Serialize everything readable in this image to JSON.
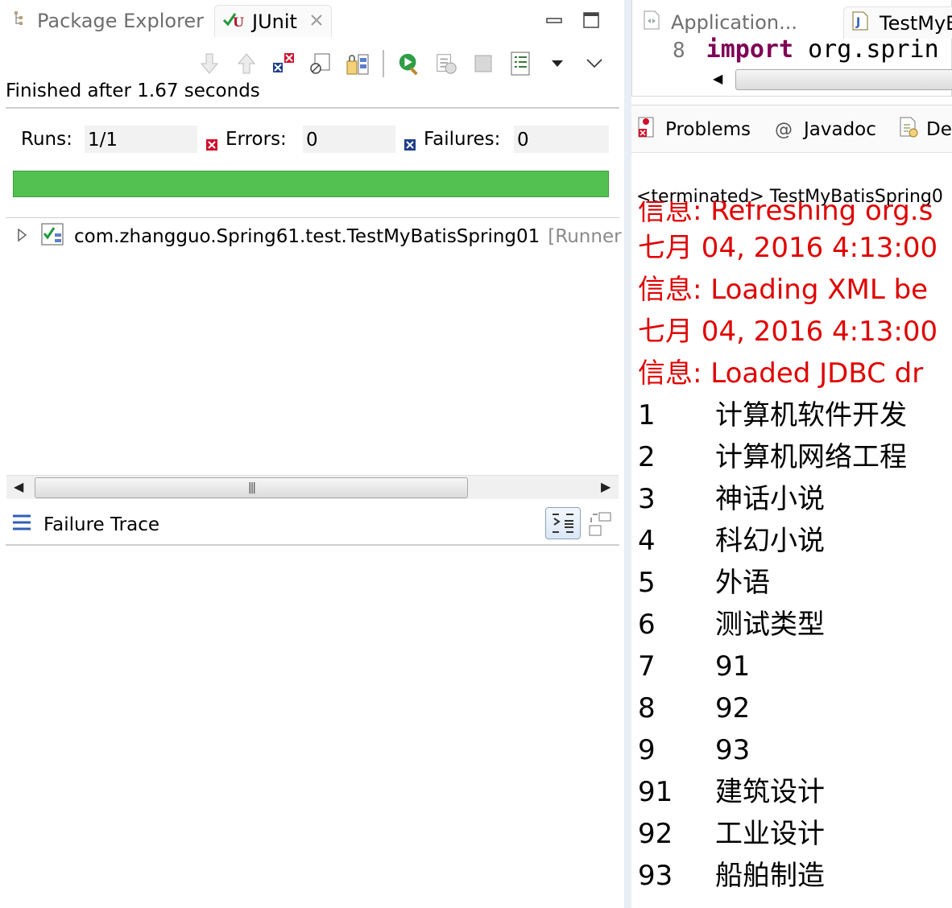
{
  "left": {
    "tabs": [
      {
        "label": "Package Explorer",
        "icon": "package-explorer-icon",
        "active": false
      },
      {
        "label": "JUnit",
        "icon": "junit-icon",
        "active": true
      }
    ],
    "toolbar_icons": [
      "next-failure-icon",
      "previous-failure-icon",
      "show-failures-only-icon",
      "scroll-lock-icon",
      "history-icon",
      "rerun-test-icon",
      "rerun-failed-first-icon",
      "stop-icon",
      "test-run-history-icon",
      "view-menu-icon"
    ],
    "status": "Finished after 1.67 seconds",
    "counters": {
      "runs_label": "Runs:",
      "runs_value": "1/1",
      "errors_label": "Errors:",
      "errors_value": "0",
      "failures_label": "Failures:",
      "failures_value": "0"
    },
    "progress_fraction": 1.0,
    "progress_color": "#52c152",
    "tree": {
      "label": "com.zhangguo.Spring61.test.TestMyBatisSpring01",
      "runner": "[Runner"
    },
    "failure_trace": {
      "label": "Failure Trace"
    }
  },
  "right": {
    "editor_tabs": [
      {
        "label": "Application...",
        "icon": "xml-file-icon"
      },
      {
        "label": "TestMyB",
        "icon": "java-file-icon"
      }
    ],
    "code": {
      "line_number": "8",
      "keyword": "import",
      "text": " org.sprin"
    },
    "console_tabs": [
      {
        "label": "Problems",
        "icon": "problems-icon"
      },
      {
        "label": "Javadoc",
        "icon": "javadoc-icon"
      },
      {
        "label": "De",
        "icon": "declaration-icon"
      }
    ],
    "terminated": "<terminated> TestMyBatisSpring0",
    "log_lines": [
      {
        "text": "信息: Refreshing org.s",
        "red": true,
        "clipped": true
      },
      {
        "text": "七月 04, 2016 4:13:00",
        "red": true
      },
      {
        "text": "信息: Loading XML be",
        "red": true
      },
      {
        "text": "七月 04, 2016 4:13:00",
        "red": true
      },
      {
        "text": "信息: Loaded JDBC dr",
        "red": true
      }
    ],
    "rows": [
      {
        "id": "1",
        "name": "计算机软件开发"
      },
      {
        "id": "2",
        "name": "计算机网络工程"
      },
      {
        "id": "3",
        "name": "神话小说"
      },
      {
        "id": "4",
        "name": "科幻小说"
      },
      {
        "id": "5",
        "name": "外语"
      },
      {
        "id": "6",
        "name": "测试类型"
      },
      {
        "id": "7",
        "name": "91"
      },
      {
        "id": "8",
        "name": "92"
      },
      {
        "id": "9",
        "name": "93"
      },
      {
        "id": "91",
        "name": "建筑设计"
      },
      {
        "id": "92",
        "name": "工业设计"
      },
      {
        "id": "93",
        "name": "船舶制造"
      }
    ]
  }
}
